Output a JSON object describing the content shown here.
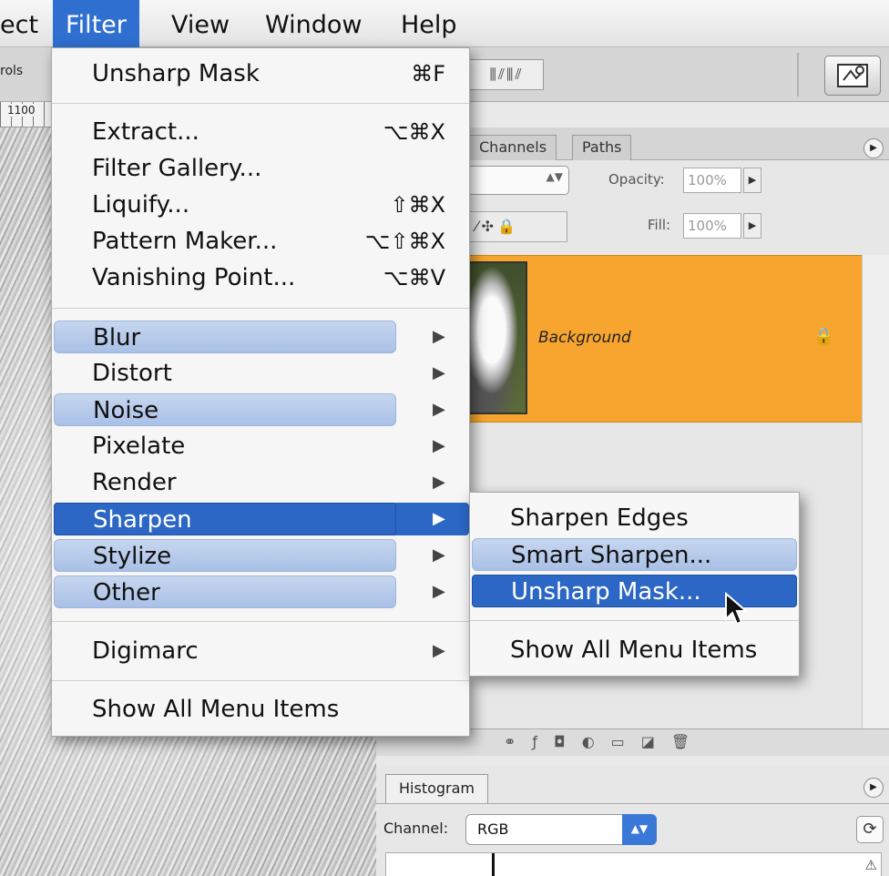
{
  "menubar": {
    "items": [
      "ect",
      "Filter",
      "View",
      "Window",
      "Help"
    ]
  },
  "toolbar": {
    "label": "rols",
    "icons_name": "align-icons"
  },
  "ruler": {
    "label": "1100"
  },
  "layers_palette": {
    "tabs": [
      "Channels",
      "Paths"
    ],
    "opacity_label": "Opacity:",
    "opacity_value": "100%",
    "fill_label": "Fill:",
    "fill_value": "100%",
    "layer_name": "Background"
  },
  "histogram": {
    "tab": "Histogram",
    "channel_label": "Channel:",
    "channel_value": "RGB"
  },
  "filter_menu": {
    "last_filter": {
      "label": "Unsharp Mask",
      "shortcut": "⌘F"
    },
    "group1": [
      {
        "label": "Extract...",
        "shortcut": "⌥⌘X"
      },
      {
        "label": "Filter Gallery...",
        "shortcut": ""
      },
      {
        "label": "Liquify...",
        "shortcut": "⇧⌘X"
      },
      {
        "label": "Pattern Maker...",
        "shortcut": "⌥⇧⌘X"
      },
      {
        "label": "Vanishing Point...",
        "shortcut": "⌥⌘V"
      }
    ],
    "submenus": [
      "Blur",
      "Distort",
      "Noise",
      "Pixelate",
      "Render",
      "Sharpen",
      "Stylize",
      "Other"
    ],
    "digimarc": "Digimarc",
    "show_all": "Show All Menu Items"
  },
  "sharpen_submenu": {
    "items": [
      "Sharpen Edges",
      "Smart Sharpen...",
      "Unsharp Mask..."
    ],
    "show_all": "Show All Menu Items"
  },
  "colors": {
    "accent": "#2c67c6",
    "layer_highlight": "#f7a52f",
    "menu_highlight": "#b4c8ea"
  }
}
